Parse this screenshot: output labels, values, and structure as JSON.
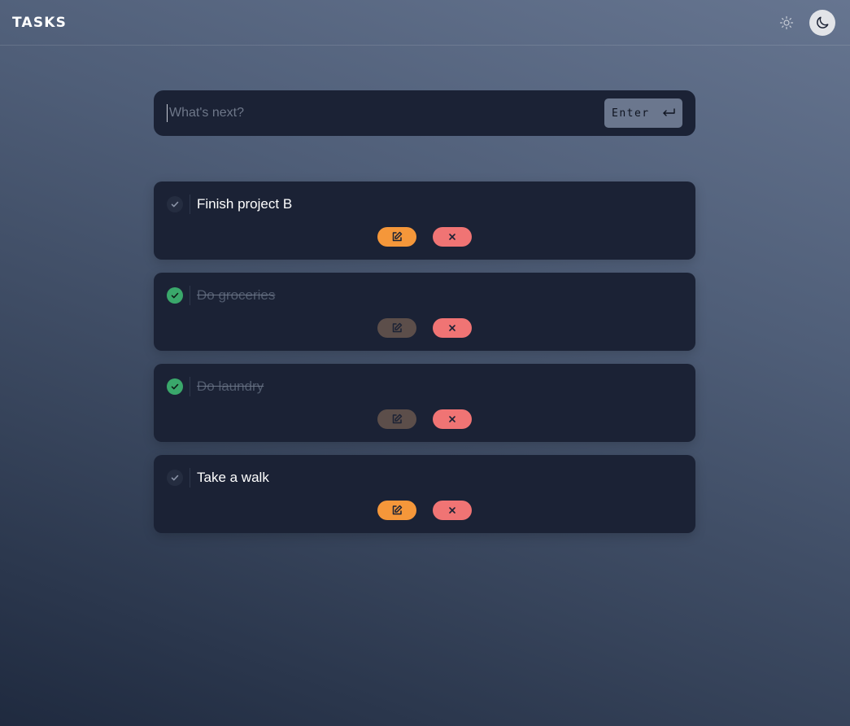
{
  "header": {
    "title": "TASKS",
    "theme_icons": [
      "sun-icon",
      "moon-icon"
    ],
    "active_theme": "dark"
  },
  "entry": {
    "placeholder": "What's next?",
    "value": "",
    "enter_label": "Enter",
    "enter_icon": "return-arrow-icon"
  },
  "tasks": [
    {
      "text": "Finish project B",
      "done": false
    },
    {
      "text": "Do groceries",
      "done": true
    },
    {
      "text": "Do laundry",
      "done": true
    },
    {
      "text": "Take a walk",
      "done": false
    }
  ],
  "colors": {
    "card": "#1b2235",
    "edit": "#f5973a",
    "edit_disabled": "#5c4e4a",
    "delete": "#f07474",
    "check_done": "#3aa86b",
    "enter_button": "#6b778e"
  }
}
